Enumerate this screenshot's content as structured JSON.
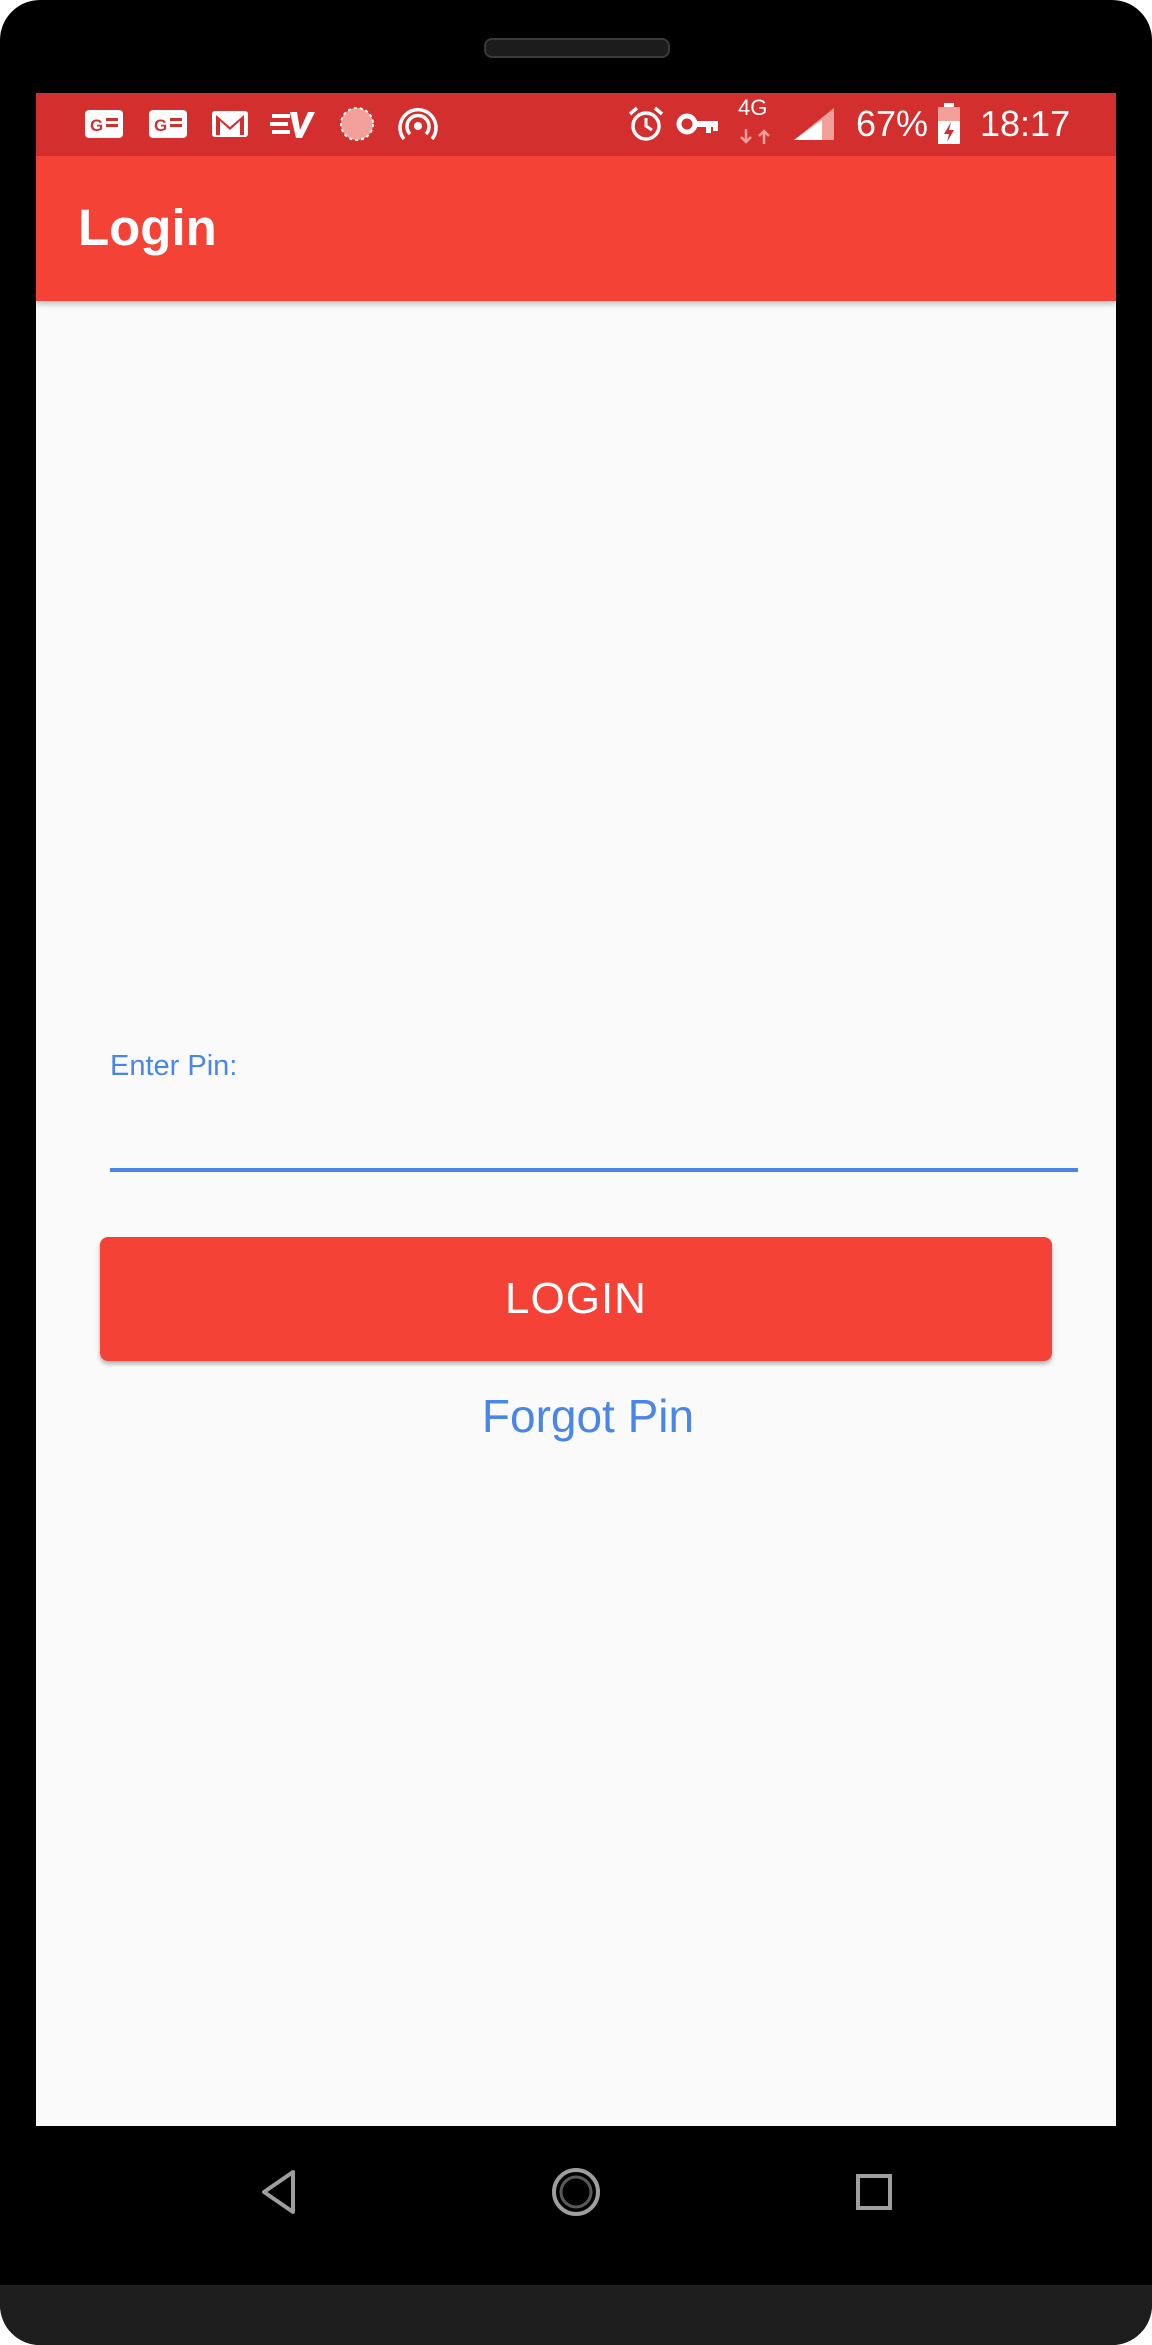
{
  "status_bar": {
    "notification_icons": [
      "news-g-icon",
      "news-g-icon",
      "gmail-icon",
      "expressvpn-icon",
      "loading-circle-icon",
      "hotspot-icon"
    ],
    "system_icons": [
      "alarm-icon",
      "vpn-key-icon",
      "signal-icon",
      "battery-icon"
    ],
    "network": "4G",
    "battery_percent": "67%",
    "time": "18:17",
    "background_color": "#d32f2f"
  },
  "app_bar": {
    "title": "Login",
    "background_color": "#f44336"
  },
  "form": {
    "pin_label": "Enter Pin:",
    "pin_value": "",
    "login_button_label": "LOGIN",
    "forgot_link_label": "Forgot Pin",
    "accent_color": "#4a86e8"
  },
  "navigation": {
    "buttons": [
      "back-icon",
      "home-icon",
      "recents-icon"
    ]
  }
}
